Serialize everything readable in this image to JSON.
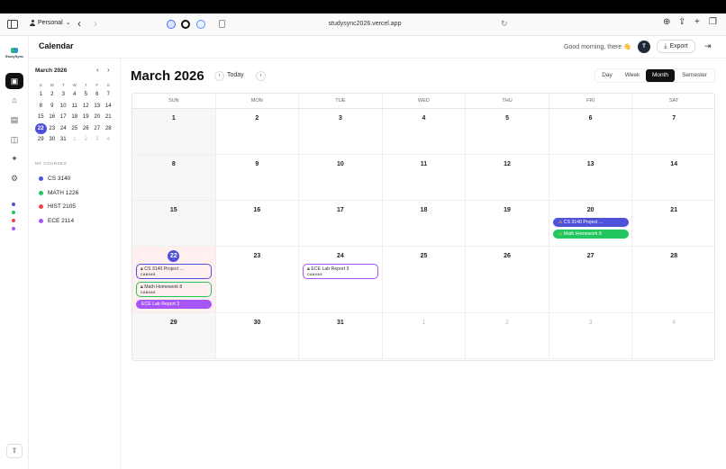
{
  "browser": {
    "profile": "Personal",
    "url": "studysync2026.vercel.app"
  },
  "app": {
    "logo_text": "StudySync",
    "page_title": "Calendar",
    "greeting": "Good morning, there 👋",
    "avatar_initial": "T",
    "export_label": "Export"
  },
  "mini_calendar": {
    "title": "March 2026",
    "weekdays": [
      "S",
      "M",
      "T",
      "W",
      "T",
      "F",
      "S"
    ],
    "days": [
      [
        "1",
        "2",
        "3",
        "4",
        "5",
        "6",
        "7"
      ],
      [
        "8",
        "9",
        "10",
        "11",
        "12",
        "13",
        "14"
      ],
      [
        "15",
        "16",
        "17",
        "18",
        "19",
        "20",
        "21"
      ],
      [
        "22",
        "23",
        "24",
        "25",
        "26",
        "27",
        "28"
      ],
      [
        "29",
        "30",
        "31",
        "1",
        "2",
        "3",
        "4"
      ]
    ]
  },
  "courses": {
    "title": "MY COURSES",
    "items": [
      {
        "name": "CS 3140",
        "color": "#4f52d9"
      },
      {
        "name": "MATH 1226",
        "color": "#22c55e"
      },
      {
        "name": "HIST 2105",
        "color": "#ef4444"
      },
      {
        "name": "ECE 2114",
        "color": "#a855f7"
      }
    ]
  },
  "calendar": {
    "title": "March 2026",
    "today_label": "Today",
    "views": [
      "Day",
      "Week",
      "Month",
      "Semester"
    ],
    "active_view": "Month",
    "weekdays": [
      "SUN",
      "MON",
      "TUE",
      "WED",
      "THU",
      "FRI",
      "SAT"
    ],
    "weeks": [
      [
        "1",
        "2",
        "3",
        "4",
        "5",
        "6",
        "7"
      ],
      [
        "8",
        "9",
        "10",
        "11",
        "12",
        "13",
        "14"
      ],
      [
        "15",
        "16",
        "17",
        "18",
        "19",
        "20",
        "21"
      ],
      [
        "22",
        "23",
        "24",
        "25",
        "26",
        "27",
        "28"
      ],
      [
        "29",
        "30",
        "31",
        "1",
        "2",
        "3",
        "4"
      ]
    ],
    "today": "22",
    "events": [
      {
        "week": 2,
        "day": 5,
        "slot": 0,
        "kind": "pill",
        "title": "CS 3140 Project ...",
        "color": "#4f52d9",
        "icon": "warning-icon"
      },
      {
        "week": 2,
        "day": 5,
        "slot": 1,
        "kind": "pill",
        "title": "Math Homework 8",
        "color": "#22c55e",
        "icon": "warning-icon"
      },
      {
        "week": 3,
        "day": 0,
        "slot": 0,
        "kind": "box",
        "title": "CS 3140 Project ...",
        "source": "CANVAS",
        "color": "#4f52d9",
        "icon": "lock-icon"
      },
      {
        "week": 3,
        "day": 0,
        "slot": 1,
        "kind": "box",
        "title": "Math Homework 8",
        "source": "CANVAS",
        "color": "#22c55e",
        "icon": "lock-icon"
      },
      {
        "week": 3,
        "day": 0,
        "slot": 2,
        "kind": "pill",
        "title": "ECE Lab Report 3",
        "color": "#a855f7"
      },
      {
        "week": 3,
        "day": 2,
        "slot": 0,
        "kind": "box",
        "title": "ECE Lab Report 3",
        "source": "CANVAS",
        "color": "#a855f7",
        "icon": "lock-icon"
      }
    ]
  }
}
